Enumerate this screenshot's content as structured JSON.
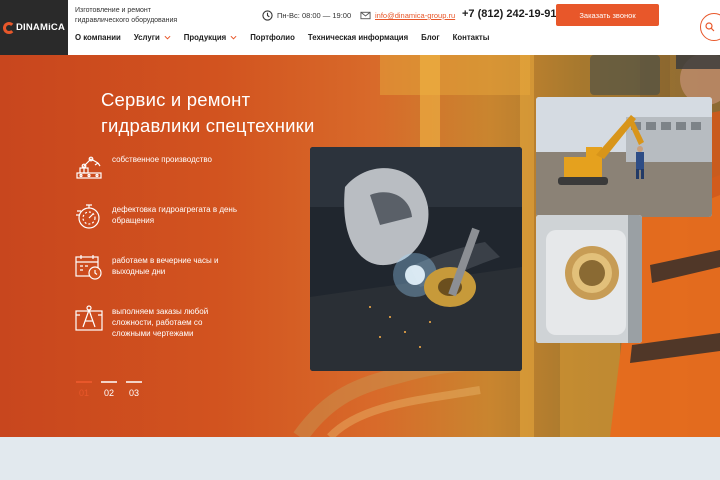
{
  "header": {
    "logo_text": "DINAMiCA",
    "tagline": "Изготовление и ремонт гидравлического оборудования",
    "hours": "Пн-Вс: 08:00 — 19:00",
    "email": "info@dinamica-group.ru",
    "phone": "+7 (812) 242-19-91",
    "callback_label": "Заказать звонок",
    "nav": [
      {
        "label": "О компании",
        "dropdown": false
      },
      {
        "label": "Услуги",
        "dropdown": true
      },
      {
        "label": "Продукция",
        "dropdown": true
      },
      {
        "label": "Портфолио",
        "dropdown": false
      },
      {
        "label": "Техническая информация",
        "dropdown": false
      },
      {
        "label": "Блог",
        "dropdown": false
      },
      {
        "label": "Контакты",
        "dropdown": false
      }
    ],
    "accent_color": "#e8572a"
  },
  "hero": {
    "title_line1": "Сервис и ремонт",
    "title_line2": "гидравлики спецтехники",
    "features": [
      {
        "icon": "robot-arm-icon",
        "text": "собственное производство"
      },
      {
        "icon": "stopwatch-icon",
        "text": "дефектовка гидроагрегата в день обращения"
      },
      {
        "icon": "calendar-clock-icon",
        "text": "работаем в вечерние часы и выходные дни"
      },
      {
        "icon": "blueprint-compass-icon",
        "text": "выполняем заказы любой сложности, работаем со сложными чертежами"
      }
    ],
    "slides": [
      "01",
      "02",
      "03"
    ],
    "active_slide": 0
  }
}
